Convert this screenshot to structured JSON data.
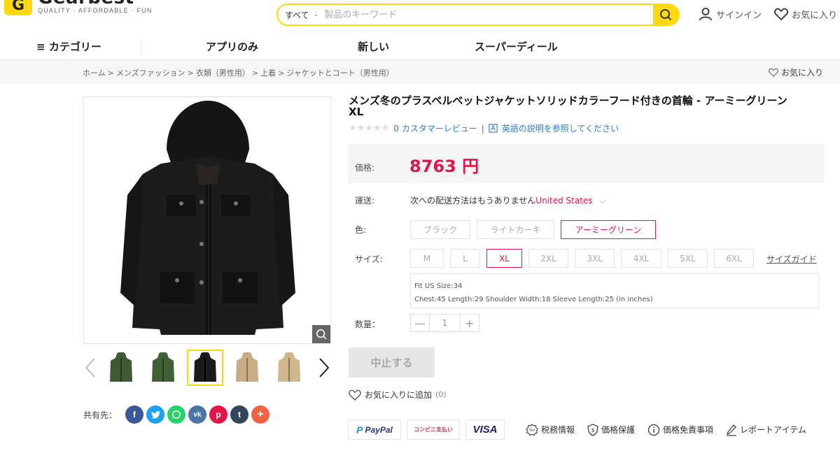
{
  "header": {
    "logo_mark": "G",
    "logo_name": "Gearbest",
    "logo_tagline": "QUALITY · AFFORDABLE · FUN",
    "search_category": "すべて",
    "search_placeholder": "製品のキーワード",
    "signin_label": "サインイン",
    "favorites_label": "お気に入り"
  },
  "nav": {
    "categories": "カテゴリー",
    "items": [
      "アプリのみ",
      "新しい",
      "スーパーディール"
    ]
  },
  "breadcrumb": {
    "items": [
      "ホーム",
      "メンズファッション",
      "衣類（男性用）",
      "上着",
      "ジャケットとコート（男性用）"
    ],
    "favorite_label": "お気に入り"
  },
  "product": {
    "title": "メンズ冬のプラスベルベットジャケットソリッドカラーフード付きの首輪 - アーミーグリーン XL",
    "stars": "★★★★★",
    "reviews": "0 カスタマーレビュー",
    "review_sep": "|",
    "english_desc": "英語の説明を参照してください",
    "price_label": "価格:",
    "price": "8763 円",
    "shipping_label": "運送:",
    "shipping_text": "次への配送方法はもうありません",
    "shipping_country": "United States",
    "color_label": "色:",
    "colors": [
      "ブラック",
      "ライトカーキ",
      "アーミーグリーン"
    ],
    "size_label": "サイズ:",
    "sizes": [
      "M",
      "L",
      "XL",
      "2XL",
      "3XL",
      "4XL",
      "5XL",
      "6XL"
    ],
    "size_guide": "サイズガイド",
    "fit_line1": "Fit US Size:34",
    "fit_line2": "Chest:45  Length:29  Shoulder Width:18  Sleeve Length:25  (in inches)",
    "qty_label": "数量：",
    "qty_minus": "—",
    "qty_value": "1",
    "qty_plus": "+",
    "stop_button": "中止する",
    "add_favorite": "お気に入りに追加",
    "favorite_count": "(0)"
  },
  "share": {
    "label": "共有先：",
    "icons": [
      {
        "name": "facebook",
        "glyph": "f",
        "color": "#3b5998"
      },
      {
        "name": "twitter",
        "glyph": "t",
        "color": "#1da1f2"
      },
      {
        "name": "whatsapp",
        "glyph": "w",
        "color": "#25d366"
      },
      {
        "name": "vk",
        "glyph": "vk",
        "color": "#4c75a3"
      },
      {
        "name": "pinterest",
        "glyph": "p",
        "color": "#e2154a"
      },
      {
        "name": "tumblr",
        "glyph": "t",
        "color": "#35465c"
      },
      {
        "name": "more",
        "glyph": "+",
        "color": "#f26140"
      }
    ]
  },
  "payments": {
    "paypal": "PayPal",
    "konbini": "コンビニ支払い",
    "visa": "VISA",
    "tax_info": "税務情報",
    "price_protection": "価格保護",
    "price_disclaimer": "価格免責事項",
    "report": "レポートアイテム"
  },
  "colors": {
    "accent_yellow": "#ffd910",
    "price_red": "#e2154a",
    "link_blue": "#2e7ac6"
  },
  "thumbnails": [
    {
      "color": "army-green",
      "fill": "#3d5a32"
    },
    {
      "color": "army-green",
      "fill": "#3f5f35"
    },
    {
      "color": "black",
      "fill": "#1a1a1a"
    },
    {
      "color": "light-khaki",
      "fill": "#c8ad84"
    },
    {
      "color": "light-khaki",
      "fill": "#cfb68c"
    }
  ]
}
